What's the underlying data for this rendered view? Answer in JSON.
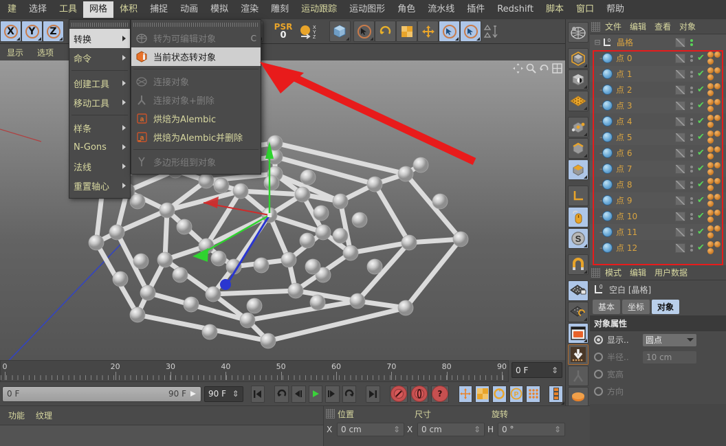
{
  "menubar": {
    "items": [
      {
        "label": "建",
        "style": "y"
      },
      {
        "label": "选择",
        "style": "n"
      },
      {
        "label": "工具",
        "style": "y"
      },
      {
        "label": "网格",
        "style": "active"
      },
      {
        "label": "体积",
        "style": "y"
      },
      {
        "label": "捕捉",
        "style": "n"
      },
      {
        "label": "动画",
        "style": "n"
      },
      {
        "label": "模拟",
        "style": "n"
      },
      {
        "label": "渲染",
        "style": "n"
      },
      {
        "label": "雕刻",
        "style": "n"
      },
      {
        "label": "运动跟踪",
        "style": "y"
      },
      {
        "label": "运动图形",
        "style": "n"
      },
      {
        "label": "角色",
        "style": "n"
      },
      {
        "label": "流水线",
        "style": "n"
      },
      {
        "label": "插件",
        "style": "n"
      },
      {
        "label": "Redshift",
        "style": "n"
      },
      {
        "label": "脚本",
        "style": "y"
      },
      {
        "label": "窗口",
        "style": "y"
      },
      {
        "label": "帮助",
        "style": "n"
      }
    ]
  },
  "dropdown": {
    "items": [
      {
        "label": "转换",
        "submenu": true,
        "highlight": true
      },
      {
        "label": "命令",
        "submenu": true,
        "highlight": false
      },
      {
        "separator_after": true
      },
      {
        "label": "创建工具",
        "submenu": true,
        "highlight": false
      },
      {
        "label": "移动工具",
        "submenu": true,
        "highlight": false
      },
      {
        "separator_after": true
      },
      {
        "label": "样条",
        "submenu": true,
        "highlight": false
      },
      {
        "label": "N-Gons",
        "submenu": true,
        "highlight": false
      },
      {
        "label": "法线",
        "submenu": true,
        "highlight": false
      },
      {
        "label": "重置轴心",
        "submenu": true,
        "highlight": false
      }
    ]
  },
  "submenu": {
    "items": [
      {
        "label": "转为可编辑对象",
        "shortcut": "C",
        "state": "disabled",
        "icon": "mesh-convert-icon"
      },
      {
        "label": "当前状态转对象",
        "shortcut": "",
        "state": "highlight",
        "icon": "current-state-icon"
      },
      {
        "separator_after": true
      },
      {
        "label": "连接对象",
        "shortcut": "",
        "state": "disabled",
        "icon": "connect-icon"
      },
      {
        "label": "连接对象+删除",
        "shortcut": "",
        "state": "disabled",
        "icon": "connect-delete-icon"
      },
      {
        "label": "烘焙为Alembic",
        "shortcut": "",
        "state": "normal",
        "icon": "alembic-icon"
      },
      {
        "label": "烘焙为Alembic并删除",
        "shortcut": "",
        "state": "normal",
        "icon": "alembic-delete-icon"
      },
      {
        "separator_after": true
      },
      {
        "label": "多边形组到对象",
        "shortcut": "",
        "state": "disabled",
        "icon": "polygroup-icon"
      }
    ]
  },
  "viewport": {
    "menu": [
      "显示",
      "选项"
    ],
    "axis_colors": {
      "x": "#d83a3a",
      "y": "#3ad23a",
      "z": "#2a3ad8"
    }
  },
  "toolbar": {
    "axis_locks": [
      "X",
      "Y",
      "Z"
    ],
    "psr_label": "PSR",
    "psr_value": "0",
    "xyz_label": "X\nY\nZ"
  },
  "object_manager": {
    "menu": [
      "文件",
      "编辑",
      "查看",
      "对象"
    ],
    "root": {
      "label": "晶格",
      "icon": "null-object-icon"
    },
    "points": [
      {
        "label": "点 0"
      },
      {
        "label": "点 1"
      },
      {
        "label": "点 2"
      },
      {
        "label": "点 3"
      },
      {
        "label": "点 4"
      },
      {
        "label": "点 5"
      },
      {
        "label": "点 6"
      },
      {
        "label": "点 7"
      },
      {
        "label": "点 8"
      },
      {
        "label": "点 9"
      },
      {
        "label": "点 10"
      },
      {
        "label": "点 11"
      },
      {
        "label": "点 12"
      }
    ]
  },
  "attribute_manager": {
    "menu": [
      "模式",
      "编辑",
      "用户数据"
    ],
    "title": "空白 [晶格]",
    "tabs": [
      {
        "label": "基本",
        "active": false
      },
      {
        "label": "坐标",
        "active": false
      },
      {
        "label": "对象",
        "active": true
      }
    ],
    "section": "对象属性",
    "properties": [
      {
        "label": "显示..",
        "type": "combo",
        "value": "圆点",
        "enabled": true
      },
      {
        "label": "半径..",
        "type": "field",
        "value": "10 cm",
        "enabled": false
      },
      {
        "label": "宽高",
        "type": "none",
        "value": "",
        "enabled": false
      },
      {
        "label": "方向",
        "type": "none",
        "value": "",
        "enabled": false
      }
    ]
  },
  "timeline": {
    "ticks": [
      {
        "label": "0",
        "pos": 0
      },
      {
        "label": "20",
        "pos": 20
      },
      {
        "label": "30",
        "pos": 30
      },
      {
        "label": "40",
        "pos": 40
      },
      {
        "label": "50",
        "pos": 50
      },
      {
        "label": "60",
        "pos": 60
      },
      {
        "label": "70",
        "pos": 70
      },
      {
        "label": "80",
        "pos": 80
      },
      {
        "label": "90",
        "pos": 90
      }
    ],
    "current_frame": "0 F",
    "range_start": "0 F",
    "range_end": "90 F",
    "end_field": "90 F"
  },
  "statusbar": {
    "tabs": [
      "功能",
      "纹理"
    ],
    "message": ""
  },
  "coordinates": {
    "headers": [
      "位置",
      "尺寸",
      "旋转"
    ],
    "rows": [
      {
        "axis1": "X",
        "value1": "0 cm",
        "axis2": "X",
        "value2": "0 cm",
        "axis3": "H",
        "value3": "0 °"
      }
    ]
  }
}
